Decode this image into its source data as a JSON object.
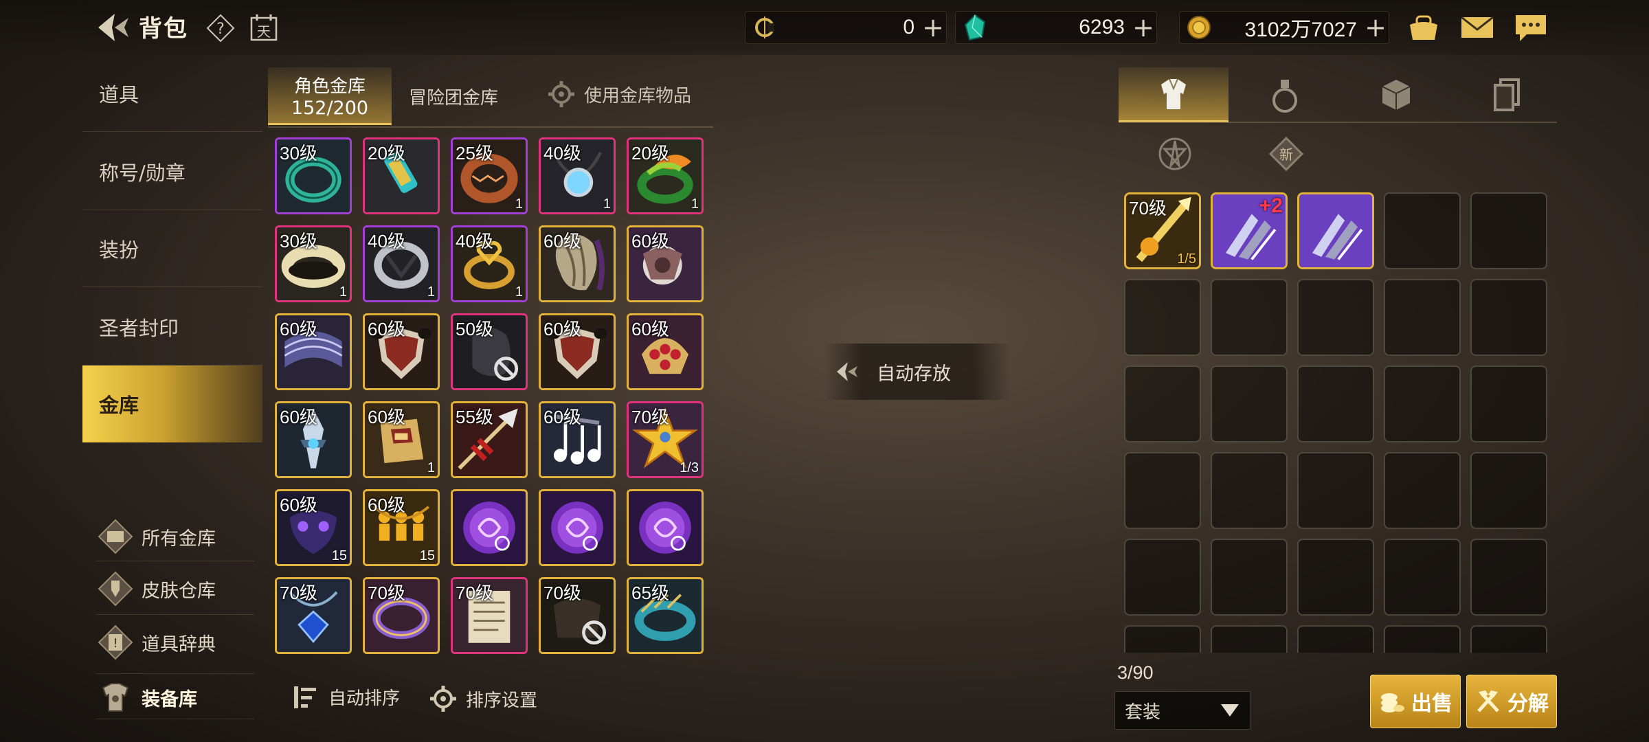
{
  "header": {
    "title": "背包",
    "help_icon": "help-icon",
    "calendar_glyph": "天",
    "currencies": [
      {
        "icon": "c-coin-icon",
        "value": "0"
      },
      {
        "icon": "green-gem-icon",
        "value": "6293"
      },
      {
        "icon": "gold-coin-icon",
        "value": "3102万7027"
      }
    ],
    "plus": "+"
  },
  "left_nav": {
    "items": [
      {
        "label": "道具"
      },
      {
        "label": "称号/勋章"
      },
      {
        "label": "装扮"
      },
      {
        "label": "圣者封印"
      },
      {
        "label": "金库"
      }
    ],
    "sub_items": [
      {
        "label": "所有金库",
        "icon": "vault-icon"
      },
      {
        "label": "皮肤仓库",
        "icon": "skin-storage-icon"
      },
      {
        "label": "道具辞典",
        "icon": "item-dictionary-icon"
      },
      {
        "label": "装备库",
        "icon": "armor-icon"
      }
    ]
  },
  "vault_tabs": {
    "character_vault": {
      "label": "角色金库",
      "count": "152/200"
    },
    "guild_vault": {
      "label": "冒险团金库"
    },
    "use_vault_items": {
      "label": "使用金库物品"
    }
  },
  "vault_items": [
    {
      "level": "30级",
      "count": "",
      "rarity": "purple",
      "art": "ring-green"
    },
    {
      "level": "20级",
      "count": "",
      "rarity": "pink",
      "art": "amulet-teal"
    },
    {
      "level": "25级",
      "count": "1",
      "rarity": "purple",
      "art": "ring-bronze"
    },
    {
      "level": "40级",
      "count": "1",
      "rarity": "pink",
      "art": "necklace-blue"
    },
    {
      "level": "20级",
      "count": "1",
      "rarity": "pink",
      "art": "ring-leaf"
    },
    {
      "level": "30级",
      "count": "1",
      "rarity": "pink",
      "art": "band-gold"
    },
    {
      "level": "40级",
      "count": "1",
      "rarity": "purple",
      "art": "ring-silver"
    },
    {
      "level": "40级",
      "count": "1",
      "rarity": "purple",
      "art": "ring-heart"
    },
    {
      "level": "60级",
      "count": "",
      "rarity": "gold",
      "art": "fur-dark"
    },
    {
      "level": "60级",
      "count": "",
      "rarity": "gold",
      "art": "gear-white"
    },
    {
      "level": "60级",
      "count": "",
      "rarity": "gold",
      "art": "belt-purple"
    },
    {
      "level": "60级",
      "count": "",
      "rarity": "gold",
      "art": "bell-red"
    },
    {
      "level": "50级",
      "count": "",
      "rarity": "pink",
      "art": "disabled"
    },
    {
      "level": "60级",
      "count": "",
      "rarity": "gold",
      "art": "bell-red"
    },
    {
      "level": "60级",
      "count": "",
      "rarity": "gold",
      "art": "crown-red"
    },
    {
      "level": "60级",
      "count": "",
      "rarity": "gold",
      "art": "blade-blue"
    },
    {
      "level": "60级",
      "count": "1",
      "rarity": "gold",
      "art": "glove-gold"
    },
    {
      "level": "55级",
      "count": "",
      "rarity": "gold",
      "art": "spear-red"
    },
    {
      "level": "60级",
      "count": "",
      "rarity": "gold",
      "art": "notes"
    },
    {
      "level": "70级",
      "count": "1/3",
      "rarity": "pink",
      "art": "star"
    },
    {
      "level": "60级",
      "count": "15",
      "rarity": "gold",
      "art": "mask-purple"
    },
    {
      "level": "60级",
      "count": "15",
      "rarity": "gold",
      "art": "figures"
    },
    {
      "level": "",
      "count": "",
      "rarity": "gold",
      "art": "orb-purple"
    },
    {
      "level": "",
      "count": "",
      "rarity": "gold",
      "art": "orb-purple"
    },
    {
      "level": "",
      "count": "",
      "rarity": "gold",
      "art": "orb-purple"
    },
    {
      "level": "70级",
      "count": "",
      "rarity": "gold",
      "art": "sapphire"
    },
    {
      "level": "70级",
      "count": "",
      "rarity": "gold",
      "art": "bangle-violet"
    },
    {
      "level": "70级",
      "count": "",
      "rarity": "pink",
      "art": "scroll"
    },
    {
      "level": "70级",
      "count": "",
      "rarity": "gold",
      "art": "disabled-dark"
    },
    {
      "level": "65级",
      "count": "",
      "rarity": "gold",
      "art": "bracelet-cyan"
    }
  ],
  "bottom_left": {
    "auto_sort": "自动排序",
    "sort_settings": "排序设置"
  },
  "auto_store": {
    "label": "自动存放"
  },
  "right_panel": {
    "tabs": [
      {
        "icon": "armor-tab-icon"
      },
      {
        "icon": "potion-tab-icon"
      },
      {
        "icon": "material-tab-icon"
      },
      {
        "icon": "cards-tab-icon"
      }
    ],
    "filters": [
      {
        "icon": "pentagram-icon"
      },
      {
        "icon": "new-icon",
        "label": "新"
      }
    ],
    "items": [
      {
        "level": "70级",
        "count": "1/5",
        "art": "weapon-gold"
      },
      {
        "level": "",
        "count": "",
        "enhance": "+2",
        "art": "claw-purple"
      },
      {
        "level": "",
        "count": "",
        "art": "claw-purple"
      }
    ],
    "capacity": "3/90",
    "dropdown_value": "套装",
    "sell_label": "出售",
    "dismantle_label": "分解"
  },
  "colors": {
    "accent_gold": "#e3b23a",
    "rarity_purple": "#a33fd6",
    "rarity_pink": "#e0337e"
  }
}
